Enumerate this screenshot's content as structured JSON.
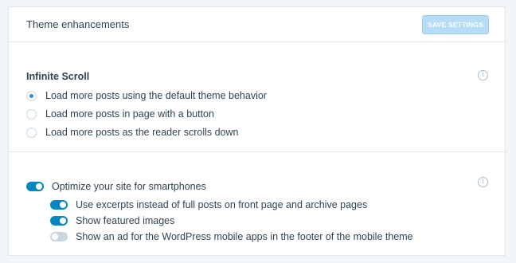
{
  "header": {
    "title": "Theme enhancements",
    "save_button": "SAVE SETTINGS",
    "accent_color": "#0087be"
  },
  "infinite_scroll": {
    "heading": "Infinite Scroll",
    "info_icon": "info-icon",
    "options": [
      {
        "label": "Load more posts using the default theme behavior",
        "selected": true
      },
      {
        "label": "Load more posts in page with a button",
        "selected": false
      },
      {
        "label": "Load more posts as the reader scrolls down",
        "selected": false
      }
    ]
  },
  "mobile": {
    "info_icon": "info-icon",
    "main_toggle": {
      "label": "Optimize your site for smartphones",
      "on": true
    },
    "sub_toggles": [
      {
        "label": "Use excerpts instead of full posts on front page and archive pages",
        "on": true
      },
      {
        "label": "Show featured images",
        "on": true
      },
      {
        "label": "Show an ad for the WordPress mobile apps in the footer of the mobile theme",
        "on": false
      }
    ]
  }
}
